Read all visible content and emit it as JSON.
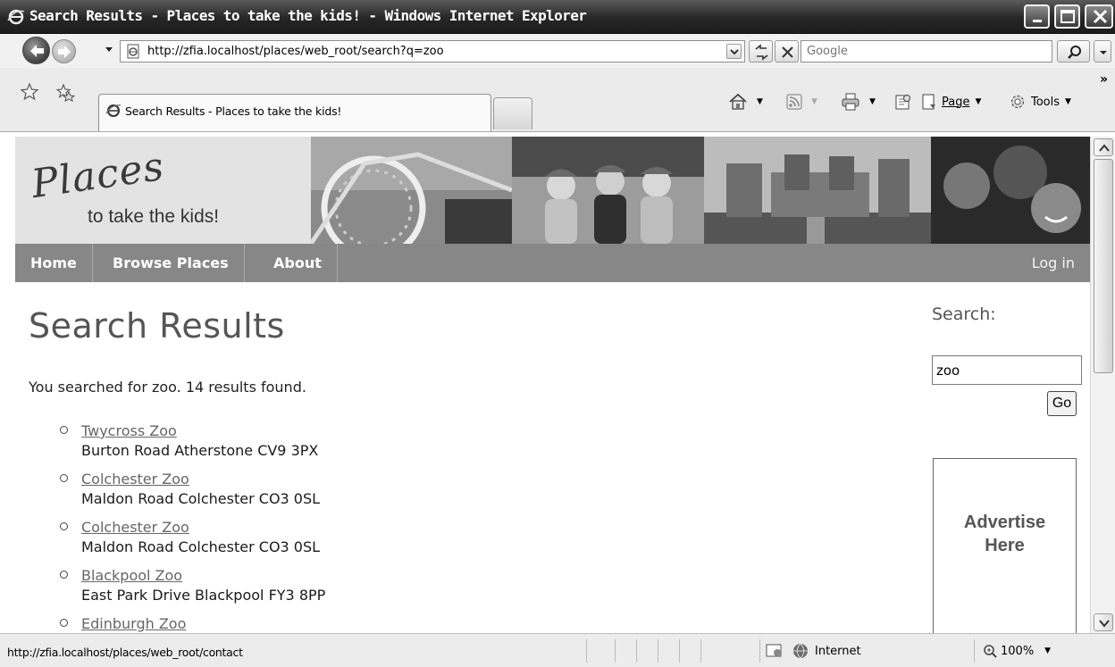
{
  "window": {
    "title": "Search Results - Places to take the kids! - Windows Internet Explorer"
  },
  "address": {
    "url": "http://zfia.localhost/places/web_root/search?q=zoo",
    "search_placeholder": "Google"
  },
  "tabs": {
    "active_label": "Search Results - Places to take the kids!"
  },
  "commands": {
    "page_label": "Page",
    "tools_label": "Tools"
  },
  "site": {
    "logo_script": "Places",
    "logo_sub": "to take the kids!",
    "nav": [
      "Home",
      "Browse Places",
      "About"
    ],
    "login": "Log in"
  },
  "main": {
    "title": "Search Results",
    "summary": "You searched for zoo. 14 results found.",
    "results": [
      {
        "name": "Twycross Zoo",
        "address": "Burton Road Atherstone CV9 3PX"
      },
      {
        "name": "Colchester Zoo",
        "address": "Maldon Road Colchester CO3 0SL"
      },
      {
        "name": "Colchester Zoo",
        "address": "Maldon Road Colchester CO3 0SL"
      },
      {
        "name": "Blackpool Zoo",
        "address": "East Park Drive Blackpool FY3 8PP"
      },
      {
        "name": "Edinburgh Zoo",
        "address": ""
      }
    ]
  },
  "sidebar": {
    "search_label": "Search:",
    "search_value": "zoo",
    "go_label": "Go",
    "ad_line1": "Advertise",
    "ad_line2": "Here"
  },
  "status": {
    "text": "http://zfia.localhost/places/web_root/contact",
    "zone": "Internet",
    "zoom": "100%"
  },
  "colors": {
    "nav_bar": "#878787",
    "header_bg": "#e3e3e3",
    "title_bar": "#262626"
  }
}
